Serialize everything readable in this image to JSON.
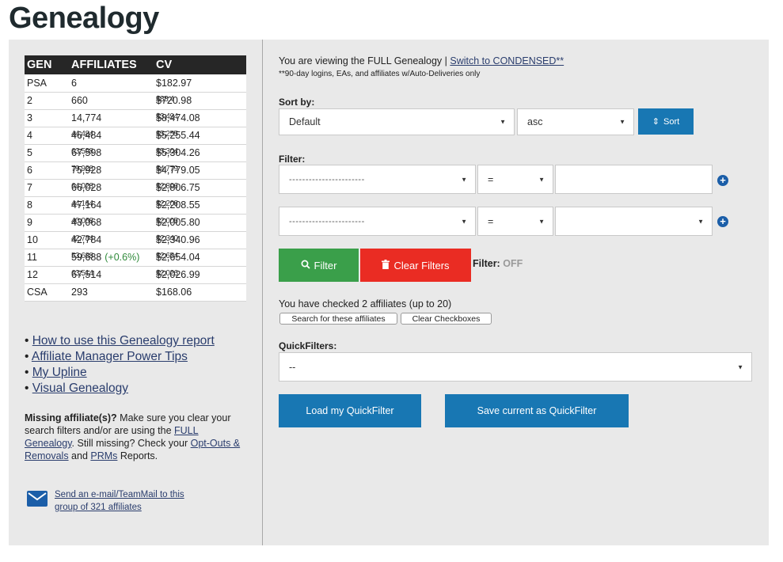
{
  "page": {
    "title": "Genealogy"
  },
  "table": {
    "headers": [
      "GEN",
      "AFFILIATES",
      "CV"
    ],
    "rows": [
      {
        "gen": "PSA",
        "affiliates": "6",
        "affiliates_overlay": "",
        "change": "",
        "cv": "$182.97",
        "cv_overlay": ""
      },
      {
        "gen": "2",
        "affiliates": "660",
        "affiliates_overlay": "",
        "change": "",
        "cv": "$720.98",
        "cv_overlay": "$88,4"
      },
      {
        "gen": "3",
        "affiliates": "14,774",
        "affiliates_overlay": "",
        "change": "",
        "cv": "$8,474.08",
        "cv_overlay": "$3,494"
      },
      {
        "gen": "4",
        "affiliates": "46,484",
        "affiliates_overlay": "44,484",
        "change": "",
        "cv": "$5,255.44",
        "cv_overlay": "$5,255"
      },
      {
        "gen": "5",
        "affiliates": "67,598",
        "affiliates_overlay": "63,598",
        "change": "",
        "cv": "$5,304.26",
        "cv_overlay": "$5,304"
      },
      {
        "gen": "6",
        "affiliates": "75,928",
        "affiliates_overlay": "79,928",
        "change": "",
        "cv": "$4,779.05",
        "cv_overlay": "$4,779"
      },
      {
        "gen": "7",
        "affiliates": "66,028",
        "affiliates_overlay": "64,028",
        "change": "",
        "cv": "$2,806.75",
        "cv_overlay": "$2,806"
      },
      {
        "gen": "8",
        "affiliates": "47,164",
        "affiliates_overlay": "44,164",
        "change": "",
        "cv": "$2,208.55",
        "cv_overlay": "$2,208"
      },
      {
        "gen": "9",
        "affiliates": "43,068",
        "affiliates_overlay": "40,068",
        "change": "",
        "cv": "$2,005.80",
        "cv_overlay": "$2,005"
      },
      {
        "gen": "10",
        "affiliates": "42,784",
        "affiliates_overlay": "42,784",
        "change": "",
        "cv": "$2,340.96",
        "cv_overlay": "$2,340"
      },
      {
        "gen": "11",
        "affiliates": "59,688",
        "affiliates_overlay": "53,688",
        "change": "(+0.6%)",
        "cv": "$2,654.04",
        "cv_overlay": "$2,654"
      },
      {
        "gen": "12",
        "affiliates": "67,514",
        "affiliates_overlay": "63,514",
        "change": "",
        "cv": "$2,026.99",
        "cv_overlay": "$2,026"
      },
      {
        "gen": "CSA",
        "affiliates": "293",
        "affiliates_overlay": "",
        "change": "",
        "cv": "$168.06",
        "cv_overlay": ""
      }
    ]
  },
  "links": [
    "How to use this Genealogy report",
    "Affiliate Manager Power Tips",
    "My Upline",
    "Visual Genealogy"
  ],
  "missing": {
    "bold": "Missing affiliate(s)?",
    "text1": " Make sure you clear your search filters and/or are using the ",
    "link1": "FULL Genealogy",
    "text2": ". Still missing? Check your ",
    "link2": "Opt-Outs & Removals",
    "text3": " and ",
    "link3": "PRMs",
    "text4": " Reports."
  },
  "mail": {
    "line1": "Send an e-mail/TeamMail to this",
    "line2": "group of 321 affiliates"
  },
  "viewing": {
    "text": "You are viewing the FULL Genealogy | ",
    "switch_link": "Switch to CONDENSED**",
    "note": "**90-day logins, EAs, and affiliates w/Auto-Deliveries only"
  },
  "sort": {
    "label": "Sort by:",
    "field": "Default",
    "order": "asc",
    "button": "Sort"
  },
  "filter": {
    "label": "Filter:",
    "row1": {
      "field": "-----------------------",
      "op": "=",
      "value": ""
    },
    "row2": {
      "field": "-----------------------",
      "op": "=",
      "value": ""
    },
    "filter_button": "Filter",
    "clear_button": "Clear Filters",
    "state_label": "Filter:",
    "state_value": "OFF"
  },
  "checked": {
    "text": "You have checked 2 affiliates (up to 20)",
    "search_button": "Search for these affiliates",
    "clear_button": "Clear Checkboxes"
  },
  "quickfilters": {
    "label": "QuickFilters:",
    "selected": "--",
    "load_button": "Load my QuickFilter",
    "save_button": "Save current as QuickFilter"
  }
}
